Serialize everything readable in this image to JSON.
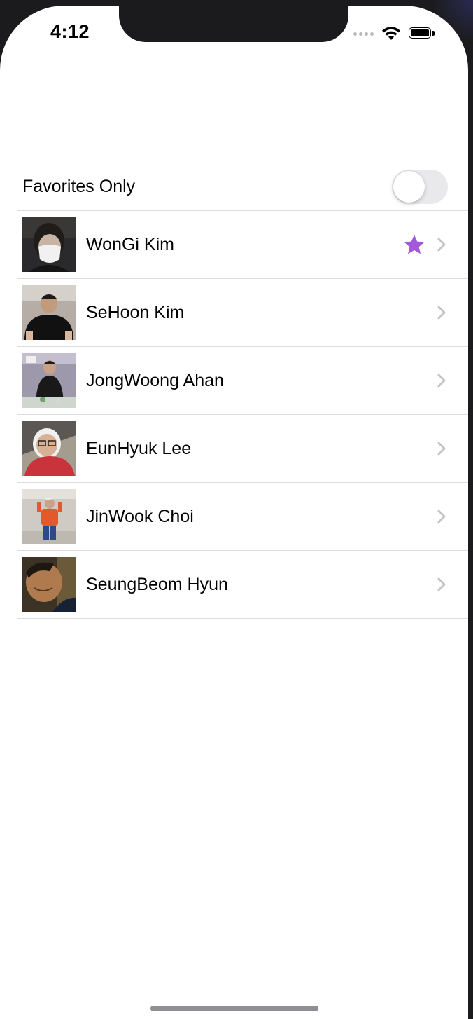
{
  "status_bar": {
    "time": "4:12",
    "icons": [
      "cellular-signal-icon",
      "wifi-icon",
      "battery-icon"
    ]
  },
  "favorites_toggle": {
    "label": "Favorites Only",
    "on": false
  },
  "friends": [
    {
      "name": "WonGi Kim",
      "favorite": true,
      "avatar": "photo"
    },
    {
      "name": "SeHoon Kim",
      "favorite": false,
      "avatar": "photo"
    },
    {
      "name": "JongWoong Ahan",
      "favorite": false,
      "avatar": "photo"
    },
    {
      "name": "EunHyuk Lee",
      "favorite": false,
      "avatar": "photo"
    },
    {
      "name": "JinWook Choi",
      "favorite": false,
      "avatar": "photo"
    },
    {
      "name": "SeungBeom Hyun",
      "favorite": false,
      "avatar": "photo"
    }
  ],
  "colors": {
    "favorite_star": "#a259d9",
    "chevron": "#c4c4c7",
    "separator": "#dcdcdf",
    "toggle_off": "#e9e9eb"
  }
}
